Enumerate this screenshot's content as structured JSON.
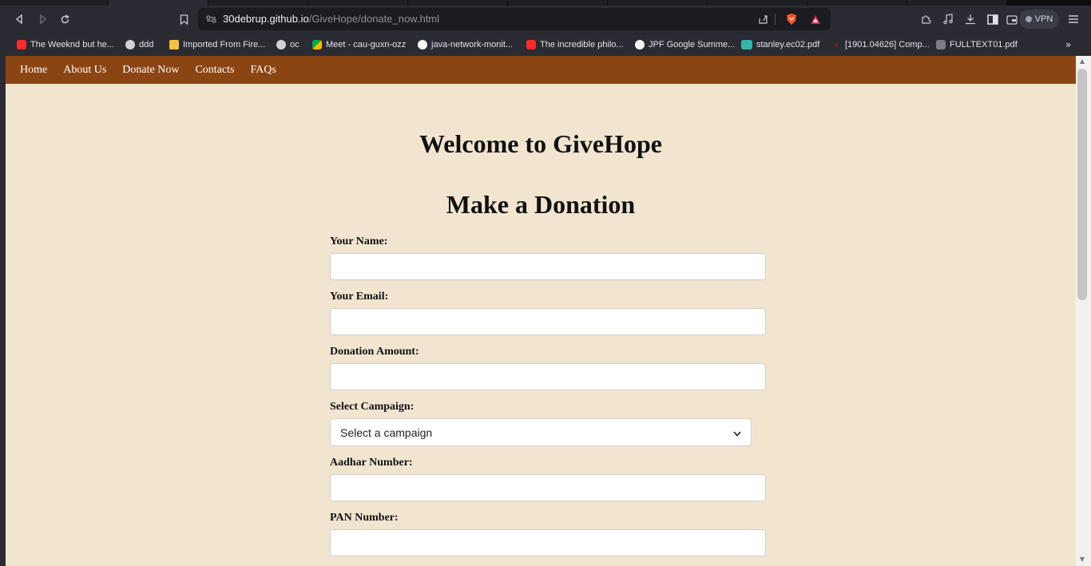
{
  "browser": {
    "url_host": "30debrup.github.io",
    "url_path": "/GiveHope/donate_now.html",
    "vpn_label": "VPN",
    "bookmarks": [
      {
        "label": "The Weeknd but he...",
        "icon": "youtube-icon"
      },
      {
        "label": "ddd",
        "icon": "globe-icon"
      },
      {
        "label": "Imported From Fire...",
        "icon": "folder-icon"
      },
      {
        "label": "oc",
        "icon": "globe-icon"
      },
      {
        "label": "Meet - cau-guxn-ozz",
        "icon": "meet-icon"
      },
      {
        "label": "java-network-monit...",
        "icon": "github-icon"
      },
      {
        "label": "The incredible philo...",
        "icon": "youtube-icon"
      },
      {
        "label": "JPF Google Summe...",
        "icon": "github-icon"
      },
      {
        "label": "stanley.ec02.pdf",
        "icon": "notion-icon"
      },
      {
        "label": "[1901.04626] Comp...",
        "icon": "arxiv-icon"
      },
      {
        "label": "FULLTEXT01.pdf",
        "icon": "pdf-icon"
      }
    ],
    "bookmarks_more": "»"
  },
  "nav": {
    "items": [
      "Home",
      "About Us",
      "Donate Now",
      "Contacts",
      "FAQs"
    ]
  },
  "page": {
    "welcome_title": "Welcome to GiveHope",
    "form_title": "Make a Donation"
  },
  "form": {
    "name_label": "Your Name:",
    "email_label": "Your Email:",
    "amount_label": "Donation Amount:",
    "campaign_label": "Select Campaign:",
    "campaign_selected": "Select a campaign",
    "aadhar_label": "Aadhar Number:",
    "pan_label": "PAN Number:"
  },
  "colors": {
    "nav_bg": "#8b4513",
    "page_bg": "#f2e5d0"
  }
}
